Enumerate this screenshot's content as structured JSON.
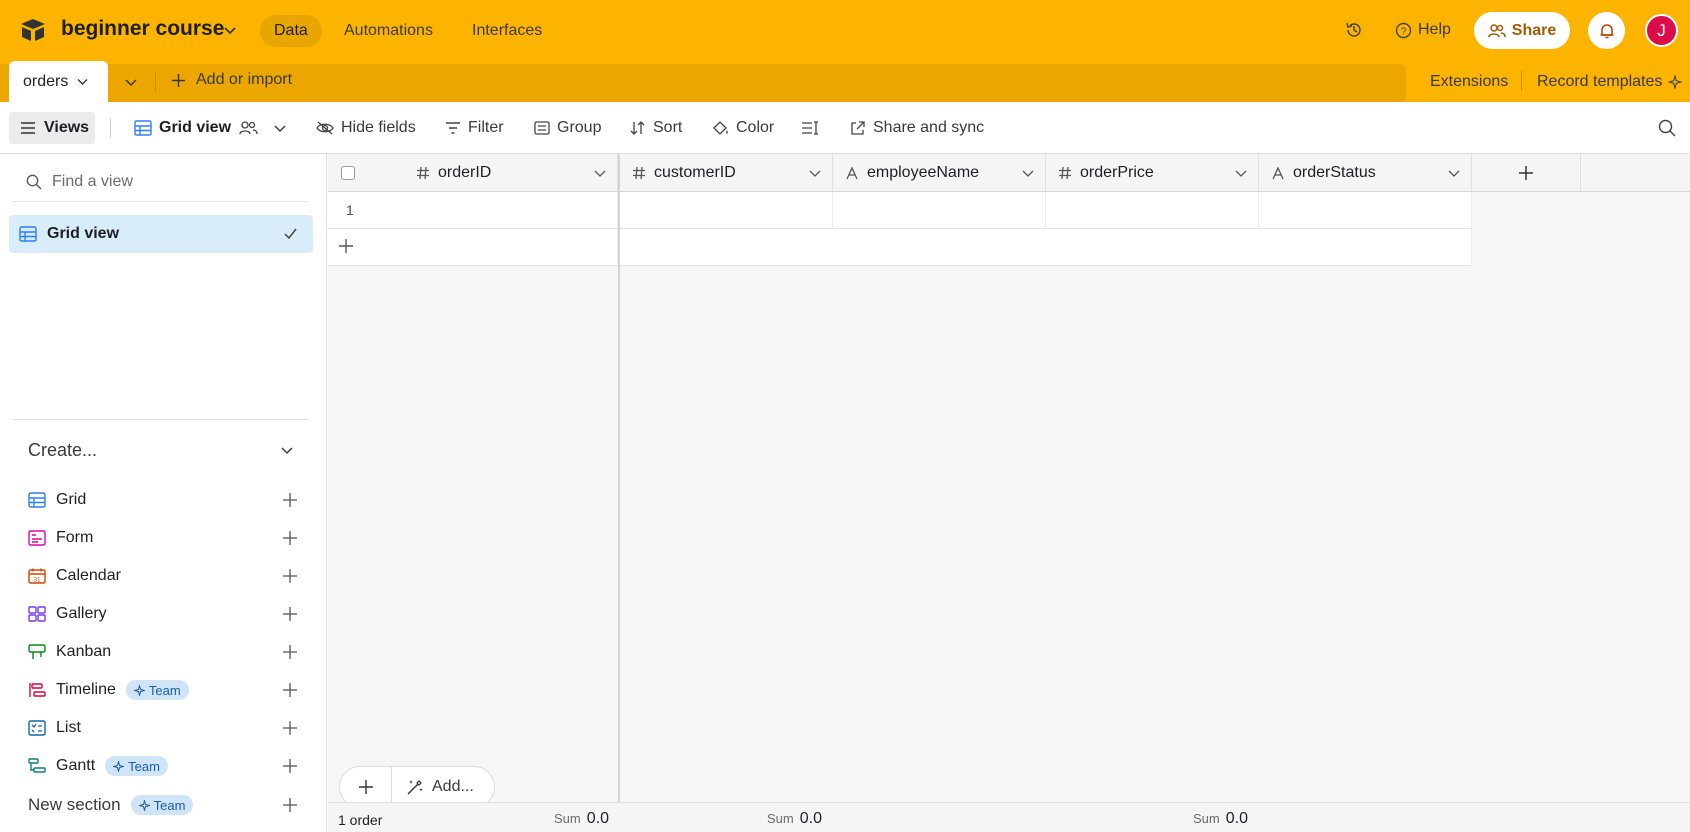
{
  "app": {
    "base_name": "beginner course",
    "nav_tabs": [
      {
        "label": "Data",
        "active": true
      },
      {
        "label": "Automations",
        "active": false
      },
      {
        "label": "Interfaces",
        "active": false
      }
    ],
    "help_label": "Help",
    "share_label": "Share",
    "avatar_initial": "J",
    "accent_color": "#fcb400"
  },
  "tabbar": {
    "table_tab_label": "orders",
    "add_import_label": "Add or import",
    "extensions_label": "Extensions",
    "record_templates_label": "Record templates"
  },
  "viewbar": {
    "views_label": "Views",
    "view_name": "Grid view",
    "hide_fields": "Hide fields",
    "filter": "Filter",
    "group": "Group",
    "sort": "Sort",
    "color": "Color",
    "share_sync": "Share and sync"
  },
  "sidebar": {
    "find_placeholder": "Find a view",
    "selected_view": "Grid view",
    "create_title": "Create...",
    "create_items": [
      {
        "label": "Grid",
        "icon": "grid-icon",
        "color": "#2d7ff9"
      },
      {
        "label": "Form",
        "icon": "form-icon",
        "color": "#dd04a8"
      },
      {
        "label": "Calendar",
        "icon": "calendar-icon",
        "color": "#d54401"
      },
      {
        "label": "Gallery",
        "icon": "gallery-icon",
        "color": "#7c39ed"
      },
      {
        "label": "Kanban",
        "icon": "kanban-icon",
        "color": "#048a0e"
      },
      {
        "label": "Timeline",
        "icon": "timeline-icon",
        "color": "#dc043b",
        "badge": "Team"
      },
      {
        "label": "List",
        "icon": "list-icon",
        "color": "#0f68a2"
      },
      {
        "label": "Gantt",
        "icon": "gantt-icon",
        "color": "#0d7f78",
        "badge": "Team"
      }
    ],
    "new_section": {
      "label": "New section",
      "badge": "Team"
    }
  },
  "grid": {
    "columns": [
      {
        "name": "orderID",
        "type": "number"
      },
      {
        "name": "customerID",
        "type": "number"
      },
      {
        "name": "employeeName",
        "type": "text"
      },
      {
        "name": "orderPrice",
        "type": "number"
      },
      {
        "name": "orderStatus",
        "type": "text"
      }
    ],
    "rows": [
      {
        "num": "1",
        "values": [
          "",
          "",
          "",
          "",
          ""
        ]
      }
    ],
    "add_label": "Add...",
    "record_count": "1 order",
    "summaries": [
      {
        "label": "Sum",
        "value": "0.0"
      },
      {
        "label": "Sum",
        "value": "0.0"
      },
      {
        "label": "Sum",
        "value": "0.0"
      }
    ]
  }
}
